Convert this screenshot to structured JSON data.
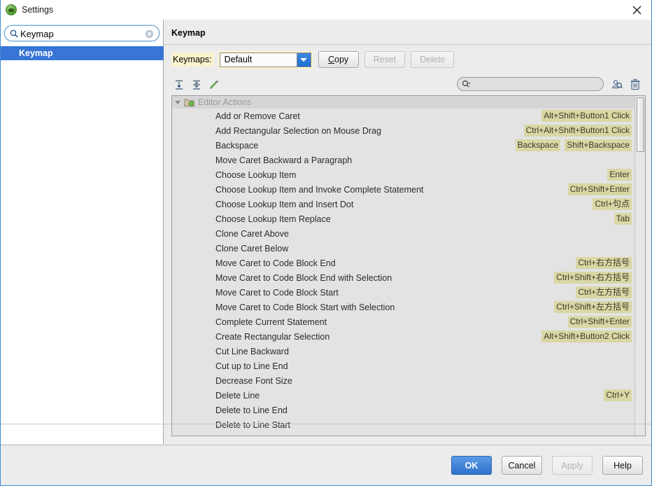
{
  "window": {
    "title": "Settings",
    "app_icon": "android-studio-icon",
    "close_icon": "close-icon",
    "accent_color": "#3875d7",
    "highlight_color": "#d9d7a4",
    "search_highlight_color": "#fbf3cd"
  },
  "sidebar": {
    "search": {
      "value": "Keymap",
      "placeholder": "",
      "search_icon": "search-icon",
      "clear_icon": "clear-circle-icon"
    },
    "items": [
      {
        "label": "Keymap",
        "selected": true
      }
    ]
  },
  "panel": {
    "title": "Keymap",
    "keymaps_label": "Keymaps:",
    "keymap_selected": "Default",
    "keymap_options": [
      "Default"
    ],
    "buttons": [
      {
        "label": "Copy",
        "mnemonic": "C",
        "enabled": true
      },
      {
        "label": "Reset",
        "enabled": false
      },
      {
        "label": "Delete",
        "enabled": false
      }
    ],
    "toolbar": [
      {
        "name": "expand-all-icon",
        "tooltip": "Expand All"
      },
      {
        "name": "collapse-all-icon",
        "tooltip": "Collapse All"
      },
      {
        "name": "edit-shortcut-icon",
        "tooltip": "Edit Shortcut"
      }
    ],
    "filter": {
      "value": "",
      "placeholder": "",
      "search_icon": "search-dropdown-icon"
    },
    "filter_actions": [
      {
        "name": "find-by-shortcut-icon"
      },
      {
        "name": "clear-filter-trash-icon"
      }
    ],
    "scrollbar": {
      "thumb_top_pct": 0,
      "thumb_height_pct": 16
    }
  },
  "tree": {
    "group": {
      "label": "Editor Actions",
      "expanded": true,
      "icon": "folder-icon"
    },
    "rows": [
      {
        "name": "Add or Remove Caret",
        "shortcuts": [
          "Alt+Shift+Button1  Click"
        ]
      },
      {
        "name": "Add Rectangular Selection on Mouse Drag",
        "shortcuts": [
          "Ctrl+Alt+Shift+Button1  Click"
        ]
      },
      {
        "name": "Backspace",
        "shortcuts": [
          "Backspace",
          "Shift+Backspace"
        ]
      },
      {
        "name": "Move Caret Backward a Paragraph",
        "shortcuts": []
      },
      {
        "name": "Choose Lookup Item",
        "shortcuts": [
          "Enter"
        ]
      },
      {
        "name": "Choose Lookup Item and Invoke Complete Statement",
        "shortcuts": [
          "Ctrl+Shift+Enter"
        ]
      },
      {
        "name": "Choose Lookup Item and Insert Dot",
        "shortcuts": [
          "Ctrl+句点"
        ]
      },
      {
        "name": "Choose Lookup Item Replace",
        "shortcuts": [
          "Tab"
        ]
      },
      {
        "name": "Clone Caret Above",
        "shortcuts": []
      },
      {
        "name": "Clone Caret Below",
        "shortcuts": []
      },
      {
        "name": "Move Caret to Code Block End",
        "shortcuts": [
          "Ctrl+右方括号"
        ]
      },
      {
        "name": "Move Caret to Code Block End with Selection",
        "shortcuts": [
          "Ctrl+Shift+右方括号"
        ]
      },
      {
        "name": "Move Caret to Code Block Start",
        "shortcuts": [
          "Ctrl+左方括号"
        ]
      },
      {
        "name": "Move Caret to Code Block Start with Selection",
        "shortcuts": [
          "Ctrl+Shift+左方括号"
        ]
      },
      {
        "name": "Complete Current Statement",
        "shortcuts": [
          "Ctrl+Shift+Enter"
        ]
      },
      {
        "name": "Create Rectangular Selection",
        "shortcuts": [
          "Alt+Shift+Button2 Click"
        ]
      },
      {
        "name": "Cut Line Backward",
        "shortcuts": []
      },
      {
        "name": "Cut up to Line End",
        "shortcuts": []
      },
      {
        "name": "Decrease Font Size",
        "shortcuts": []
      },
      {
        "name": "Delete Line",
        "shortcuts": [
          "Ctrl+Y"
        ]
      },
      {
        "name": "Delete to Line End",
        "shortcuts": []
      },
      {
        "name": "Delete to Line Start",
        "shortcuts": []
      }
    ]
  },
  "footer": {
    "buttons": [
      {
        "label": "OK",
        "style": "primary",
        "enabled": true
      },
      {
        "label": "Cancel",
        "style": "normal",
        "enabled": true
      },
      {
        "label": "Apply",
        "style": "normal",
        "enabled": false
      },
      {
        "label": "Help",
        "style": "normal",
        "enabled": true
      }
    ]
  }
}
